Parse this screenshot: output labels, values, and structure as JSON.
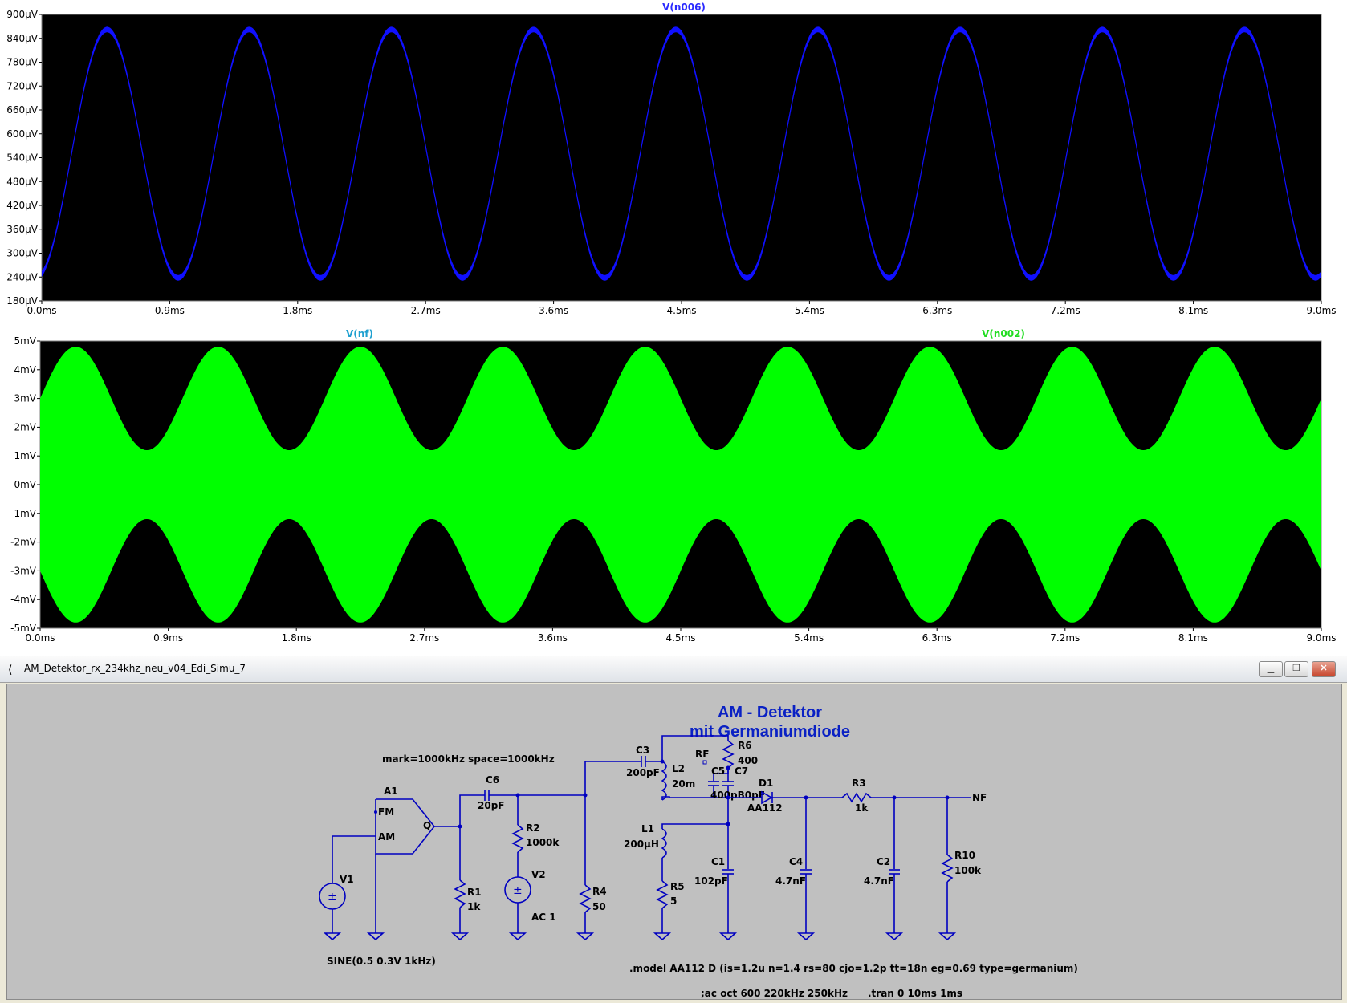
{
  "plots": [
    {
      "trace_labels": [
        {
          "text": "V(n006)",
          "color": "#2a2aff"
        }
      ],
      "y_ticks": [
        "900µV",
        "840µV",
        "780µV",
        "720µV",
        "660µV",
        "600µV",
        "540µV",
        "480µV",
        "420µV",
        "360µV",
        "300µV",
        "240µV",
        "180µV"
      ],
      "x_ticks": [
        "0.0ms",
        "0.9ms",
        "1.8ms",
        "2.7ms",
        "3.6ms",
        "4.5ms",
        "5.4ms",
        "6.3ms",
        "7.2ms",
        "8.1ms",
        "9.0ms"
      ]
    },
    {
      "trace_labels": [
        {
          "text": "V(nf)",
          "color": "#1ea0d0"
        },
        {
          "text": "V(n002)",
          "color": "#22dd22"
        }
      ],
      "y_ticks": [
        "5mV",
        "4mV",
        "3mV",
        "2mV",
        "1mV",
        "0mV",
        "-1mV",
        "-2mV",
        "-3mV",
        "-4mV",
        "-5mV"
      ],
      "x_ticks": [
        "0.0ms",
        "0.9ms",
        "1.8ms",
        "2.7ms",
        "3.6ms",
        "4.5ms",
        "5.4ms",
        "6.3ms",
        "7.2ms",
        "8.1ms",
        "9.0ms"
      ]
    }
  ],
  "chart_data": [
    {
      "type": "line",
      "title": "V(n006)",
      "xlabel": "",
      "ylabel": "",
      "xlim": [
        0,
        9.0
      ],
      "x_unit": "ms",
      "ylim": [
        180,
        900
      ],
      "y_unit": "µV",
      "series": [
        {
          "name": "V(n006)",
          "color": "#1010ff",
          "model": "sine",
          "frequency_kHz": 1.0,
          "min": 238,
          "max": 862,
          "band": 14,
          "phase_at_0": 248
        }
      ],
      "grid": false
    },
    {
      "type": "area",
      "title": "",
      "xlabel": "",
      "ylabel": "",
      "xlim": [
        0,
        9.0
      ],
      "x_unit": "ms",
      "ylim": [
        -5,
        5
      ],
      "y_unit": "mV",
      "series": [
        {
          "name": "V(n002)",
          "color": "#00ff00",
          "model": "am_envelope",
          "carrier": "234kHz",
          "modulation_kHz": 1.0,
          "envelope_max": 4.8,
          "envelope_min": 1.2,
          "envelope_at_0": 3.0
        }
      ],
      "grid": false
    }
  ],
  "window": {
    "title": "AM_Detektor_rx_234khz_neu_v04_Edi_Simu_7",
    "buttons": {
      "minimize": "▁",
      "restore": "❐",
      "close": "✕"
    }
  },
  "schematic": {
    "title_line1": "AM - Detektor",
    "title_line2": "mit Germaniumdiode",
    "source_params": "mark=1000kHz space=1000kHz",
    "components": {
      "A1": "A1",
      "FM": "FM",
      "AM": "AM",
      "Q": "Q",
      "V1": "V1",
      "V1_val": "SINE(0.5 0.3V 1kHz)",
      "C6": "C6",
      "C6_val": "20pF",
      "R1": "R1",
      "R1_val": "1k",
      "R2": "R2",
      "R2_val": "1000k",
      "V2": "V2",
      "V2_val": "AC 1",
      "R4": "R4",
      "R4_val": "50",
      "C3": "C3",
      "C3_val": "200pF",
      "L2": "L2",
      "L2_val": "20m",
      "RF": "RF",
      "R6": "R6",
      "R6_val": "400",
      "C5": "C5",
      "C7": "C7",
      "C5C7_val": "400pB0pF",
      "L1": "L1",
      "L1_val": "200µH",
      "R5": "R5",
      "R5_val": "5",
      "C1": "C1",
      "C1_val": "102pF",
      "D1": "D1",
      "D1_val": "AA112",
      "C4": "C4",
      "C4_val": "4.7nF",
      "R3": "R3",
      "R3_val": "1k",
      "C2": "C2",
      "C2_val": "4.7nF",
      "R10": "R10",
      "R10_val": "100k",
      "NF": "NF"
    },
    "directives": {
      "model": ".model AA112 D (is=1.2u n=1.4 rs=80 cjo=1.2p tt=18n eg=0.69 type=germanium)",
      "ac": ";ac oct 600 220kHz 250kHz",
      "tran": ".tran 0 10ms 1ms"
    }
  }
}
